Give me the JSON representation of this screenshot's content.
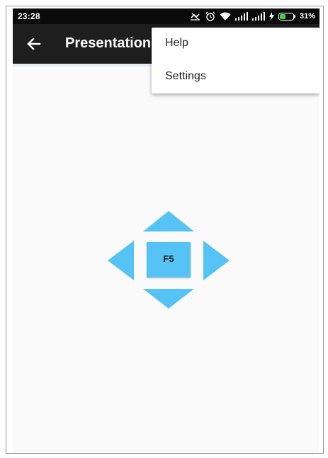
{
  "status_bar": {
    "time": "23:28",
    "battery_percent": "31%",
    "icons": [
      "data-saver-icon",
      "alarm-icon",
      "wifi-icon",
      "signal-icon",
      "signal-icon",
      "charging-icon",
      "battery-icon"
    ]
  },
  "app_bar": {
    "back_icon": "arrow-left-icon",
    "title": "Presentation"
  },
  "overflow_menu": {
    "items": [
      {
        "label": "Help"
      },
      {
        "label": "Settings"
      }
    ]
  },
  "remote": {
    "center_key_label": "F5",
    "arrows": [
      "up",
      "left",
      "right",
      "down"
    ]
  },
  "colors": {
    "accent": "#55c3f5",
    "app_bar": "#1e1e1e",
    "status_bar": "#0b0b0b",
    "background": "#fafafa"
  }
}
